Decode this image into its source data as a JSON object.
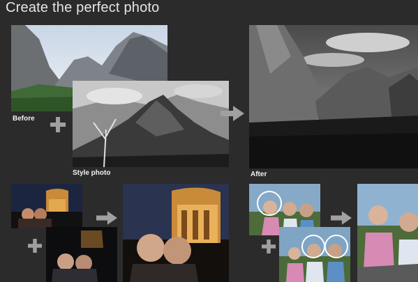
{
  "header": {
    "title": "Create the perfect photo"
  },
  "labels": {
    "before": "Before",
    "style_photo": "Style photo",
    "after": "After"
  },
  "icons": {
    "plus": "plus-icon",
    "arrow": "arrow-right-icon"
  },
  "colors": {
    "background": "#2b2b2b",
    "symbol_gray": "#a0a0a0"
  }
}
